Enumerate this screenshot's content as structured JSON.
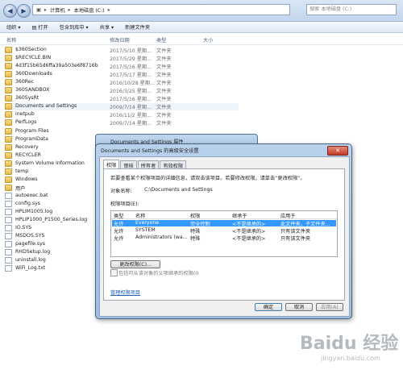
{
  "address": {
    "crumbs": [
      "计算机",
      "本地磁盘 (C:)"
    ],
    "search_placeholder": "搜索 本地磁盘 (C:)"
  },
  "toolbar": {
    "organize": "组织 ▾",
    "open": "打开",
    "include_library": "包含到库中 ▾",
    "share": "共享 ▾",
    "new_folder": "新建文件夹"
  },
  "columns": {
    "name": "名称",
    "date": "修改日期",
    "type": "类型",
    "size": "大小"
  },
  "files": [
    {
      "name": "$360Section",
      "date": "2017/5/10 星期...",
      "type": "文件夹",
      "kind": "folder"
    },
    {
      "name": "$RECYCLE.BIN",
      "date": "2017/5/29 星期...",
      "type": "文件夹",
      "kind": "folder"
    },
    {
      "name": "4d3f15b65d6ffa39a503e6f8716b",
      "date": "2017/5/16 星期...",
      "type": "文件夹",
      "kind": "folder"
    },
    {
      "name": "360Downloads",
      "date": "2017/5/17 星期...",
      "type": "文件夹",
      "kind": "folder"
    },
    {
      "name": "360Rec",
      "date": "2016/10/28 星期...",
      "type": "文件夹",
      "kind": "folder"
    },
    {
      "name": "360SANDBOX",
      "date": "2016/3/25 星期...",
      "type": "文件夹",
      "kind": "folder"
    },
    {
      "name": "360SysRt",
      "date": "2017/5/16 星期...",
      "type": "文件夹",
      "kind": "folder"
    },
    {
      "name": "Documents and Settings",
      "date": "2009/7/14 星期...",
      "type": "文件夹",
      "kind": "folder"
    },
    {
      "name": "inetpub",
      "date": "2016/11/2 星期...",
      "type": "文件夹",
      "kind": "folder"
    },
    {
      "name": "PerfLogs",
      "date": "2009/7/14 星期...",
      "type": "文件夹",
      "kind": "folder"
    },
    {
      "name": "Program Files",
      "date": "",
      "type": "",
      "kind": "folder"
    },
    {
      "name": "ProgramData",
      "date": "",
      "type": "",
      "kind": "folder"
    },
    {
      "name": "Recovery",
      "date": "",
      "type": "",
      "kind": "folder"
    },
    {
      "name": "RECYCLER",
      "date": "",
      "type": "",
      "kind": "folder"
    },
    {
      "name": "System Volume Information",
      "date": "",
      "type": "",
      "kind": "folder"
    },
    {
      "name": "temp",
      "date": "",
      "type": "",
      "kind": "folder"
    },
    {
      "name": "Windows",
      "date": "",
      "type": "",
      "kind": "folder"
    },
    {
      "name": "用户",
      "date": "",
      "type": "",
      "kind": "folder"
    },
    {
      "name": "autoexec.bat",
      "date": "",
      "type": "",
      "kind": "file"
    },
    {
      "name": "config.sys",
      "date": "",
      "type": "",
      "kind": "file"
    },
    {
      "name": "HPLIM1005.log",
      "date": "",
      "type": "",
      "kind": "file"
    },
    {
      "name": "HPLIP1000_P1500_Series.log",
      "date": "",
      "type": "",
      "kind": "file"
    },
    {
      "name": "IO.SYS",
      "date": "",
      "type": "",
      "kind": "file"
    },
    {
      "name": "MSDOS.SYS",
      "date": "",
      "type": "",
      "kind": "file"
    },
    {
      "name": "pagefile.sys",
      "date": "",
      "type": "",
      "kind": "file"
    },
    {
      "name": "RHDSetup.log",
      "date": "",
      "type": "",
      "kind": "file"
    },
    {
      "name": "uninstall.log",
      "date": "",
      "type": "",
      "kind": "file"
    },
    {
      "name": "WiFi_Log.txt",
      "date": "",
      "type": "",
      "kind": "file"
    }
  ],
  "props_dialog": {
    "title": "Documents and Settings 属性"
  },
  "adv_dialog": {
    "title": "Documents and Settings 的高级安全设置",
    "tabs": [
      "权限",
      "审核",
      "所有者",
      "有效权限"
    ],
    "info": "若要查看某个权限项目的详细信息，请双击该项目。若要修改权限，请单击“更改权限”。",
    "object_label": "对象名称:",
    "object_value": "C:\\Documents and Settings",
    "entries_label": "权限项目(E):",
    "headers": [
      "类型",
      "名称",
      "权限",
      "继承于",
      "应用于"
    ],
    "rows": [
      [
        "允许",
        "Everyone",
        "完全控制",
        "<不是继承的>",
        "此文件夹，子文件夹..."
      ],
      [
        "允许",
        "SYSTEM",
        "特殊",
        "<不是继承的>",
        "只有该文件夹"
      ],
      [
        "允许",
        "Administrators (wa...",
        "特殊",
        "<不是继承的>",
        "只有该文件夹"
      ]
    ],
    "change_btn": "更改权限(C)...",
    "inherit_check": "包括可从该对象的父项继承的权限(I)",
    "manage_link": "管理权限项目",
    "ok": "确定",
    "cancel": "取消",
    "apply": "应用(A)"
  },
  "watermark": {
    "main": "Baidu 经验",
    "sub": "jingyan.baidu.com"
  }
}
